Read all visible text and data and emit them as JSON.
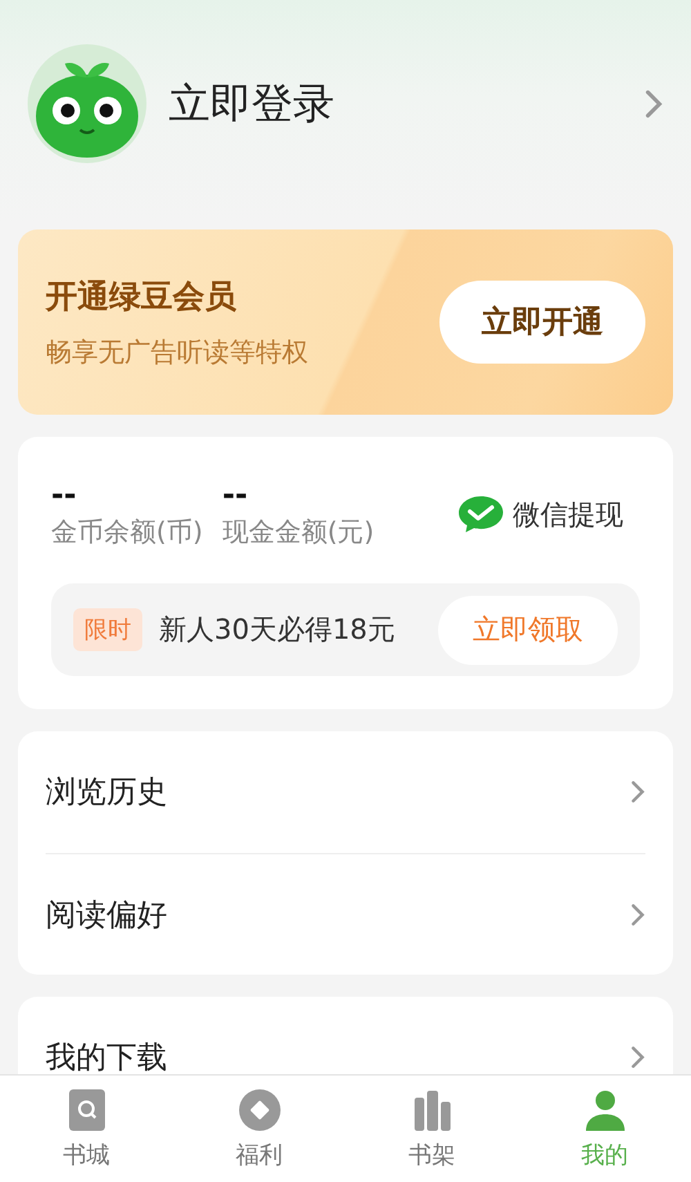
{
  "profile": {
    "login_label": "立即登录"
  },
  "vip_banner": {
    "title": "开通绿豆会员",
    "subtitle": "畅享无广告听读等特权",
    "button": "立即开通"
  },
  "wallet": {
    "balances": [
      {
        "value": "--",
        "label": "金币余额(币)"
      },
      {
        "value": "--",
        "label": "现金金额(元)"
      }
    ],
    "withdraw": "微信提现",
    "promo": {
      "tag": "限时",
      "text": "新人30天必得18元",
      "button": "立即领取"
    }
  },
  "menus": [
    [
      {
        "label": "浏览历史"
      },
      {
        "label": "阅读偏好"
      }
    ],
    [
      {
        "label": "我的下载"
      }
    ]
  ],
  "tab_bar": [
    {
      "label": "书城",
      "kind": "store",
      "selected": false
    },
    {
      "label": "福利",
      "kind": "rewards",
      "selected": false
    },
    {
      "label": "书架",
      "kind": "shelf",
      "selected": false
    },
    {
      "label": "我的",
      "kind": "profile",
      "selected": true
    }
  ]
}
